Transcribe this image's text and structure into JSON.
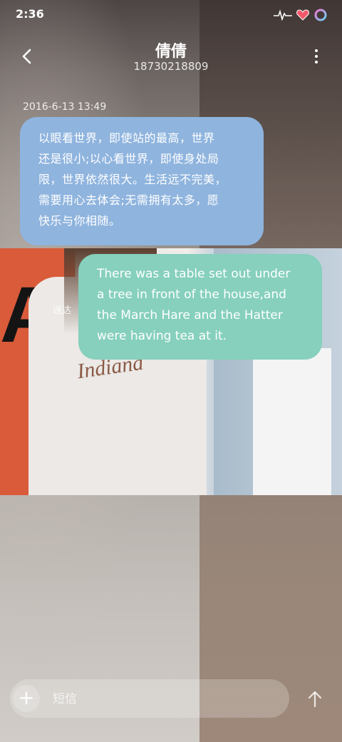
{
  "status_bar": {
    "time": "2:36",
    "icons": [
      "heartbeat-icon",
      "heart-icon",
      "ring-icon"
    ]
  },
  "header": {
    "contact_name": "倩倩",
    "contact_number": "18730218809",
    "back_icon": "chevron-left-icon",
    "more_icon": "more-vertical-icon"
  },
  "messages": [
    {
      "timestamp": "2016-6-13 13:49",
      "lines": [
        "以眼看世界，即使站的最高，世界",
        "还是很小;以心看世界，即使身处局",
        "限，世界依然很大。生活远不完美，",
        "需要用心去体会;无需拥有太多，愿",
        "快乐与你相随。"
      ],
      "color": "#8fb4de"
    },
    {
      "lines": [
        "There was a table set out under",
        "a tree in front of the house,and",
        "the March Hare and the Hatter",
        "were having tea at it."
      ],
      "color": "#86d0bd",
      "status": "送达"
    }
  ],
  "photo": {
    "sign_text": "ANK",
    "shirt_text": "Indiana"
  },
  "composer": {
    "add_label": "+",
    "placeholder": "短信"
  }
}
